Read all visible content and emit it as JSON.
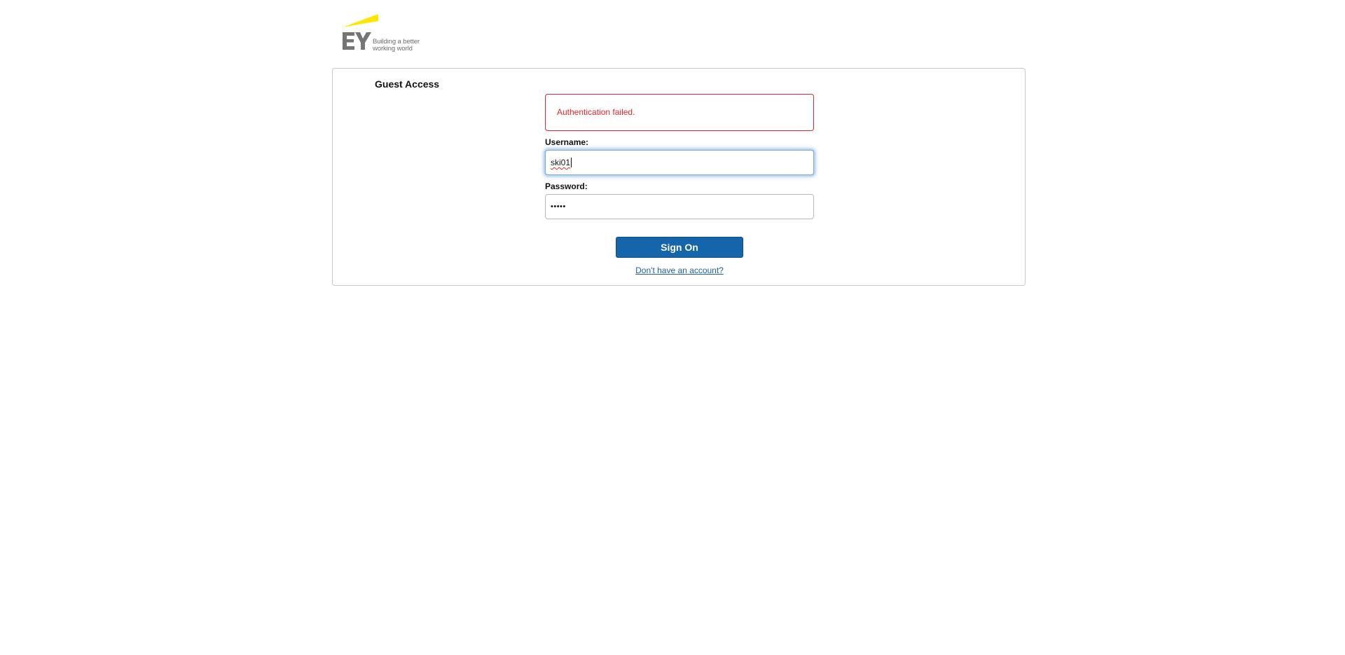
{
  "branding": {
    "logo_text": "EY",
    "tagline_line1": "Building a better",
    "tagline_line2": "working world",
    "accent_color": "#ffe600",
    "logo_gray": "#757575"
  },
  "panel": {
    "title": "Guest Access"
  },
  "alert": {
    "message": "Authentication failed.",
    "color": "#e0262c"
  },
  "form": {
    "username_label": "Username:",
    "username_value": "ski01",
    "password_label": "Password:",
    "password_mask": "•••••",
    "submit_label": "Sign On",
    "signup_link": "Don't have an account?"
  },
  "colors": {
    "button": "#1565ab",
    "link": "#1f5fa8"
  }
}
